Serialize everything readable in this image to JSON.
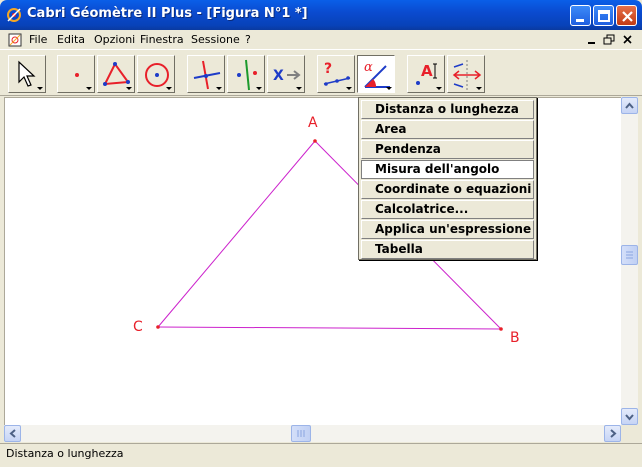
{
  "window": {
    "title": "Cabri Géomètre II Plus - [Figura N°1 *]"
  },
  "menubar": {
    "items": [
      "File",
      "Edita",
      "Opzioni",
      "Finestra",
      "Sessione",
      "?"
    ]
  },
  "toolbar": {
    "tools": [
      {
        "name": "pointer-tool",
        "icon": "arrow-pointer-icon"
      },
      {
        "name": "point-tool",
        "icon": "point-icon"
      },
      {
        "name": "triangle-tool",
        "icon": "triangle-icon"
      },
      {
        "name": "circle-tool",
        "icon": "circle-icon"
      },
      {
        "name": "construction-tool",
        "icon": "perpendicular-icon"
      },
      {
        "name": "transformation-tool",
        "icon": "symmetry-icon"
      },
      {
        "name": "macro-tool",
        "icon": "macro-icon"
      },
      {
        "name": "check-property-tool",
        "icon": "question-icon"
      },
      {
        "name": "measure-tool",
        "icon": "angle-measure-icon",
        "pressed": true
      },
      {
        "name": "display-tool",
        "icon": "label-icon"
      },
      {
        "name": "drawing-tool",
        "icon": "hide-show-icon"
      }
    ]
  },
  "measure_menu": {
    "items": [
      "Distanza o lunghezza",
      "Area",
      "Pendenza",
      "Misura dell'angolo",
      "Coordinate o equazioni",
      "Calcolatrice...",
      "Applica un'espressione",
      "Tabella"
    ],
    "selected_index": 3
  },
  "figure": {
    "points": [
      {
        "label": "A"
      },
      {
        "label": "B"
      },
      {
        "label": "C"
      }
    ],
    "point_color": "#E8202A",
    "segment_color": "#CC22CC"
  },
  "statusbar": {
    "text": "Distanza o lunghezza"
  }
}
